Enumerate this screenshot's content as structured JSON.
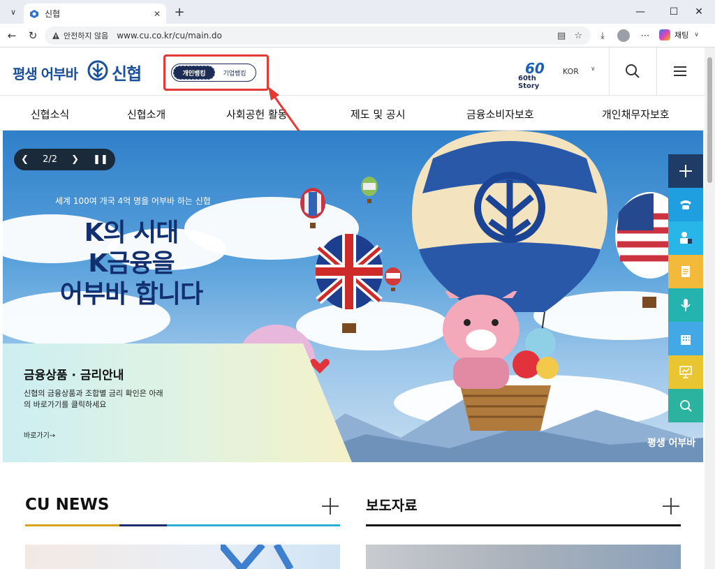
{
  "browser": {
    "tab_title": "신협",
    "insecure_label": "안전하지 않음",
    "url": "www.cu.co.kr/cu/main.do",
    "copilot_label": "채팅"
  },
  "header": {
    "slogan": "평생 어부바",
    "logo_text": "신협",
    "toggle_personal": "개인뱅킹",
    "toggle_business": "기업뱅킹",
    "story_number": "60",
    "story_label": "60th Story",
    "language": "KOR"
  },
  "gnb": {
    "items": [
      "신협소식",
      "신협소개",
      "사회공헌 활동",
      "제도 및 공시",
      "금융소비자보호",
      "개인채무자보호"
    ]
  },
  "hero": {
    "slide_counter": "2/2",
    "subtitle": "세계 100여 개국 4억 명을 어부바 하는 신협",
    "title_lines": [
      "K의 시대",
      "K금융을",
      "어부바 합니다"
    ],
    "promo_title": "금융상품 · 금리안내",
    "promo_desc": "신협의 금융상품과 조합별 금리 확인은 아래의 바로가기를 클릭하세요",
    "promo_link": "바로가기→",
    "slogan": "평생 어부바"
  },
  "sections": {
    "news_title": "CU NEWS",
    "press_title": "보도자료"
  },
  "colors": {
    "brand_blue": "#1a4f9c",
    "navy": "#1c2c54",
    "annotation_red": "#e53935",
    "quick_plus": "#1f3c66",
    "quick_phone": "#1f9ee0",
    "quick_bank": "#28b6e8",
    "quick_doc": "#f2b93b",
    "quick_mic": "#25b3b0",
    "quick_building": "#43a8e6",
    "quick_present": "#e9c531",
    "quick_search": "#2bb3a0"
  }
}
